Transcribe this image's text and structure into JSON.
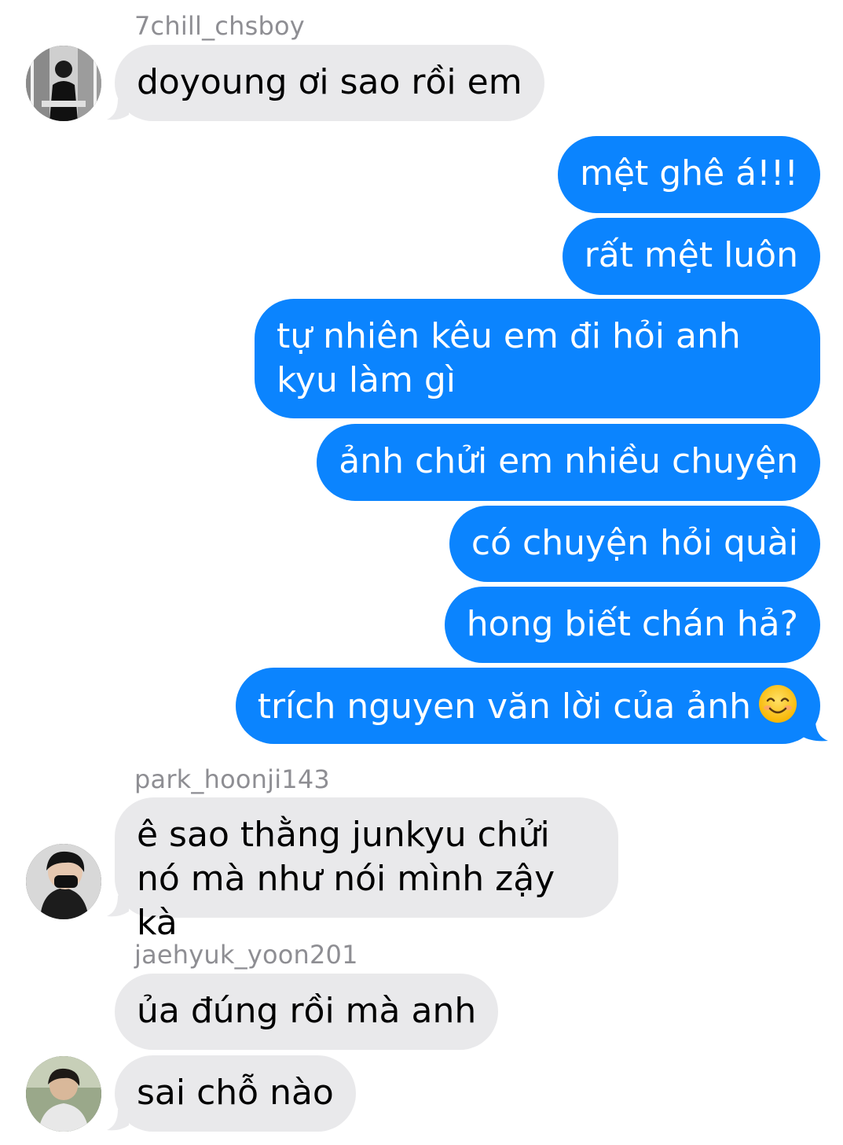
{
  "colors": {
    "incoming_bubble": "#e9e9eb",
    "outgoing_bubble": "#0b84fe",
    "sender_name": "#8e8e93"
  },
  "messages": {
    "m1": {
      "sender": "7chill_chsboy",
      "text": "doyoung ơi sao rồi em"
    },
    "m2": {
      "text": "mệt ghê á!!!"
    },
    "m3": {
      "text": "rất mệt luôn"
    },
    "m4": {
      "text": "tự nhiên kêu em đi hỏi anh kyu làm gì"
    },
    "m5": {
      "text": "ảnh chửi em nhiều chuyện"
    },
    "m6": {
      "text": "có chuyện hỏi quài"
    },
    "m7": {
      "text": "hong biết chán hả?"
    },
    "m8": {
      "text": "trích nguyen văn lời của ảnh",
      "emoji": "smiling-face-emoji"
    },
    "m9": {
      "sender": "park_hoonji143",
      "text": "ê sao thằng junkyu chửi nó mà như nói mình zậy kà"
    },
    "m10": {
      "sender": "jaehyuk_yoon201",
      "text": "ủa đúng rồi mà anh"
    },
    "m11": {
      "text": "sai chỗ nào"
    }
  }
}
